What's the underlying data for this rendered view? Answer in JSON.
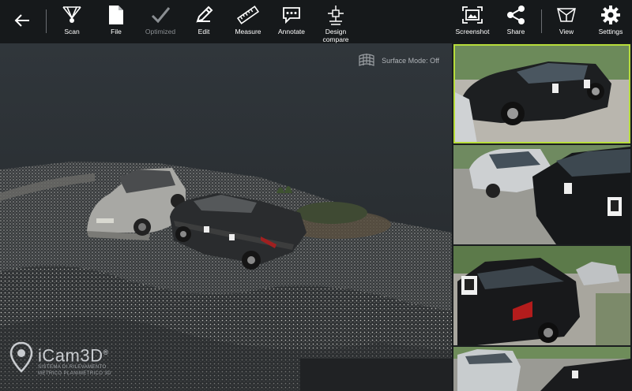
{
  "toolbar": {
    "back": {
      "icon": "back-arrow-icon"
    },
    "tools": [
      {
        "id": "scan",
        "label": "Scan",
        "icon": "scan-icon",
        "enabled": true
      },
      {
        "id": "file",
        "label": "File",
        "icon": "file-icon",
        "enabled": true
      },
      {
        "id": "optimized",
        "label": "Optimized",
        "icon": "checkmark-icon",
        "enabled": false
      },
      {
        "id": "edit",
        "label": "Edit",
        "icon": "pencil-icon",
        "enabled": true
      },
      {
        "id": "measure",
        "label": "Measure",
        "icon": "ruler-icon",
        "enabled": true
      },
      {
        "id": "annotate",
        "label": "Annotate",
        "icon": "speech-bubble-icon",
        "enabled": true
      },
      {
        "id": "design-compare",
        "label": "Design\ncompare",
        "icon": "design-compare-icon",
        "enabled": true
      }
    ],
    "right_tools": [
      {
        "id": "screenshot",
        "label": "Screenshot",
        "icon": "screenshot-icon"
      },
      {
        "id": "share",
        "label": "Share",
        "icon": "share-icon"
      },
      {
        "id": "view",
        "label": "View",
        "icon": "cube-icon"
      },
      {
        "id": "settings",
        "label": "Settings",
        "icon": "gear-icon"
      }
    ]
  },
  "viewport": {
    "surface_mode_label": "Surface Mode: Off",
    "surface_icon": "mesh-icon",
    "logo": {
      "title": "iCam3D",
      "registered": "®",
      "subtitle_line1": "SISTEMA DI RILEVAMENTO",
      "subtitle_line2": "METRICO PLANIMETRICO 3D"
    }
  },
  "thumbnails": {
    "selected_index": 0,
    "items": [
      {
        "name": "photo-1"
      },
      {
        "name": "photo-2"
      },
      {
        "name": "photo-3"
      },
      {
        "name": "photo-4"
      }
    ]
  },
  "colors": {
    "toolbar_bg": "#16191b",
    "selection": "#b6dc3a",
    "disabled_text": "#8a8e92"
  }
}
